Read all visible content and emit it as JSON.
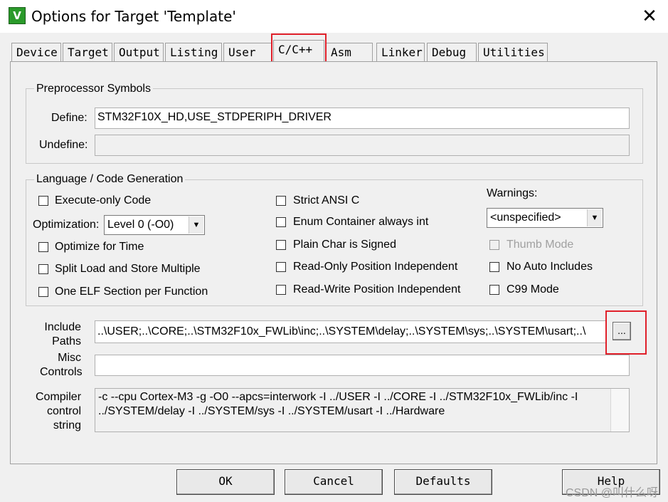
{
  "window": {
    "title": "Options for Target 'Template'",
    "app_icon": "keil-uvision-icon",
    "close": "✕"
  },
  "tabs": [
    "Device",
    "Target",
    "Output",
    "Listing",
    "User",
    "C/C++",
    "Asm",
    "Linker",
    "Debug",
    "Utilities"
  ],
  "active_tab": "C/C++",
  "preprocessor": {
    "group_title": "Preprocessor Symbols",
    "define_label": "Define:",
    "define_value": "STM32F10X_HD,USE_STDPERIPH_DRIVER",
    "undefine_label": "Undefine:",
    "undefine_value": ""
  },
  "language": {
    "group_title": "Language / Code Generation",
    "execute_only": "Execute-only Code",
    "optimization_label": "Optimization:",
    "optimization_value": "Level 0 (-O0)",
    "optimize_time": "Optimize for Time",
    "split_load": "Split Load and Store Multiple",
    "one_elf": "One ELF Section per Function",
    "strict_ansi": "Strict ANSI C",
    "enum_container": "Enum Container always int",
    "plain_char": "Plain Char is Signed",
    "ro_pos": "Read-Only Position Independent",
    "rw_pos": "Read-Write Position Independent",
    "warnings_label": "Warnings:",
    "warnings_value": "<unspecified>",
    "thumb_mode": "Thumb Mode",
    "no_auto_includes": "No Auto Includes",
    "c99_mode": "C99 Mode"
  },
  "include": {
    "label_line1": "Include",
    "label_line2": "Paths",
    "value": "..\\USER;..\\CORE;..\\STM32F10x_FWLib\\inc;..\\SYSTEM\\delay;..\\SYSTEM\\sys;..\\SYSTEM\\usart;..\\",
    "browse": "..."
  },
  "misc": {
    "label_line1": "Misc",
    "label_line2": "Controls",
    "value": ""
  },
  "compiler": {
    "label_line1": "Compiler",
    "label_line2": "control",
    "label_line3": "string",
    "line1": "-c --cpu Cortex-M3 -g -O0 --apcs=interwork -I ../USER -I ../CORE -I ../STM32F10x_FWLib/inc -I",
    "line2": "../SYSTEM/delay -I ../SYSTEM/sys -I ../SYSTEM/usart -I ../Hardware"
  },
  "buttons": {
    "ok": "OK",
    "cancel": "Cancel",
    "defaults": "Defaults",
    "help": "Help"
  },
  "watermark": "CSDN @叫什么呀",
  "colors": {
    "highlight": "#e0202a",
    "dialog_bg": "#f0f0f0"
  }
}
